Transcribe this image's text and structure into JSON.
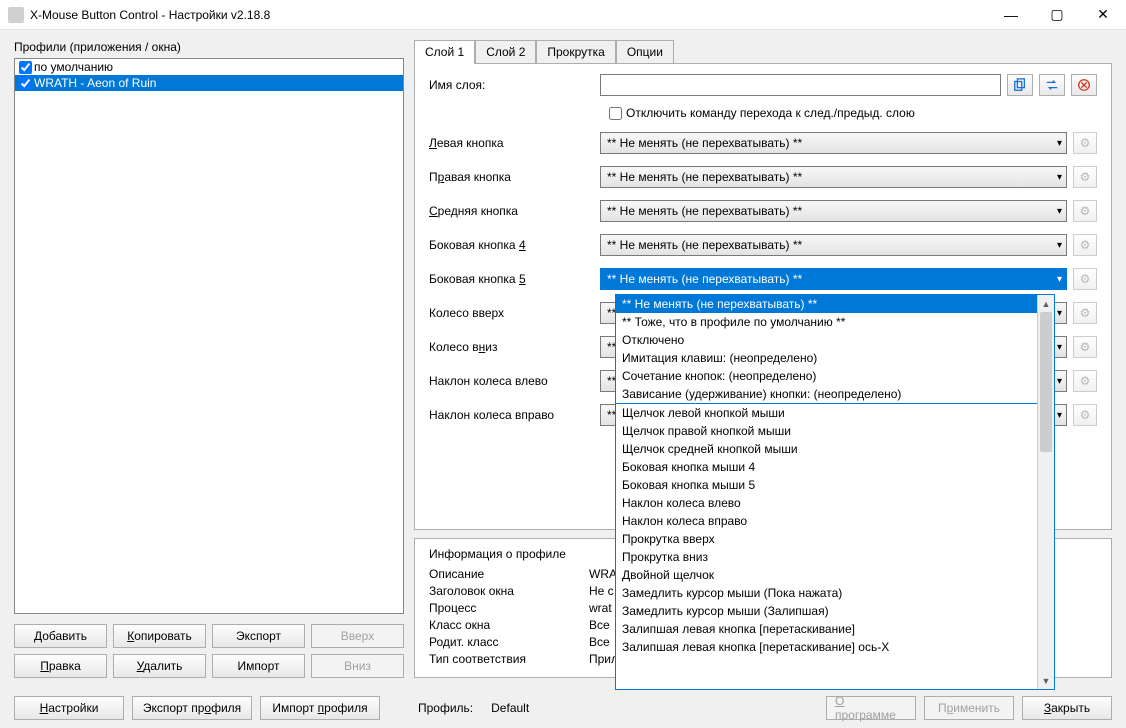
{
  "window": {
    "title": "X-Mouse Button Control - Настройки v2.18.8"
  },
  "left": {
    "section": "Профили (приложения / окна)",
    "profiles": [
      {
        "name": "по умолчанию",
        "checked": true,
        "selected": false
      },
      {
        "name": "WRATH - Aeon of Ruin",
        "checked": true,
        "selected": true
      }
    ],
    "buttons": {
      "add": "Добавить",
      "copy": "Копировать",
      "export": "Экспорт",
      "up": "Вверх",
      "edit": "Правка",
      "delete": "Удалить",
      "import": "Импорт",
      "down": "Вниз"
    }
  },
  "tabs": {
    "layer1": "Слой 1",
    "layer2": "Слой 2",
    "scroll": "Прокрутка",
    "options": "Опции"
  },
  "layer": {
    "name_label": "Имя слоя:",
    "disable_cmd": "Отключить команду перехода к след./предыд. слою",
    "rows": {
      "left": "Левая кнопка",
      "right": "Правая кнопка",
      "middle": "Средняя кнопка",
      "side4": "Боковая кнопка 4",
      "side5": "Боковая кнопка 5",
      "wheel_up": "Колесо вверх",
      "wheel_down": "Колесо вниз",
      "tilt_left": "Наклон колеса влево",
      "tilt_right": "Наклон колеса вправо"
    },
    "combo_default": "** Не менять (не перехватывать) **"
  },
  "info": {
    "title": "Информация о профиле",
    "desc_k": "Описание",
    "desc_v": "WRA",
    "wintitle_k": "Заголовок окна",
    "wintitle_v": "Не с",
    "proc_k": "Процесс",
    "proc_v": "wrat",
    "class_k": "Класс окна",
    "class_v": "Все",
    "parent_k": "Родит. класс",
    "parent_v": "Все",
    "match_k": "Тип соответствия",
    "match_v": "Прил"
  },
  "footer": {
    "settings": "Настройки",
    "export_profile": "Экспорт профиля",
    "import_profile": "Импорт профиля",
    "profile_label": "Профиль:",
    "profile_value": "Default",
    "about": "О программе",
    "apply": "Применить",
    "close": "Закрыть"
  },
  "dropdown": {
    "items": [
      "** Не менять (не перехватывать) **",
      "** Тоже, что в профиле по умолчанию **",
      "Отключено",
      "Имитация клавиш: (неопределено)",
      "Сочетание кнопок: (неопределено)",
      "Зависание (удерживание) кнопки: (неопределено)",
      "Щелчок левой кнопкой мыши",
      "Щелчок правой кнопкой мыши",
      "Щелчок средней кнопкой мыши",
      "Боковая кнопка мыши 4",
      "Боковая кнопка мыши 5",
      "Наклон колеса влево",
      "Наклон колеса вправо",
      "Прокрутка вверх",
      "Прокрутка вниз",
      "Двойной щелчок",
      "Замедлить курсор мыши (Пока нажата)",
      "Замедлить курсор мыши (Залипшая)",
      "Залипшая левая кнопка [перетаскивание]",
      "Залипшая левая кнопка [перетаскивание] ось-X"
    ]
  }
}
